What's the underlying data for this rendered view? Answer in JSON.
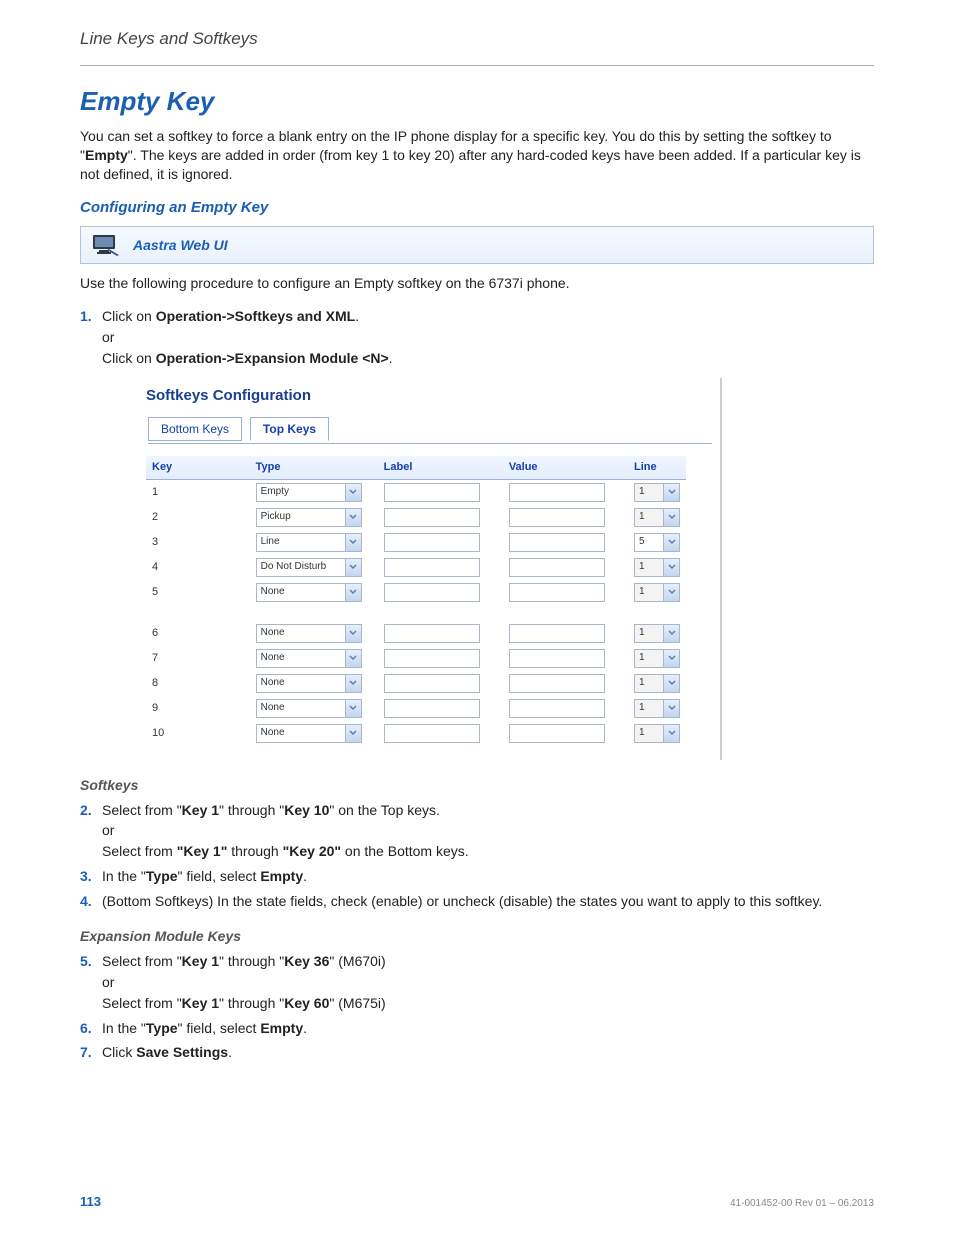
{
  "breadcrumb": "Line Keys and Softkeys",
  "title": "Empty Key",
  "intro": "You can set a softkey to force a blank entry on the IP phone display for a specific key. You do this by setting the softkey to \"",
  "intro_bold": "Empty",
  "intro_tail": "\". The keys are added in order (from key 1 to key 20) after any hard-coded keys have been added. If a particular key is not defined, it is ignored.",
  "sub1": "Configuring an Empty Key",
  "webui_label": "Aastra Web UI",
  "lead": "Use the following procedure to configure an Empty softkey on the 6737i phone.",
  "step1_a": "Click on ",
  "step1_b": "Operation->Softkeys and XML",
  "step1_c": ".",
  "or": "or",
  "step1_d": "Click on ",
  "step1_e": "Operation->Expansion Module <N>",
  "step1_f": ".",
  "screenshot": {
    "title": "Softkeys Configuration",
    "tabs": {
      "bottom": "Bottom Keys",
      "top": "Top Keys"
    },
    "headers": {
      "key": "Key",
      "type": "Type",
      "label": "Label",
      "value": "Value",
      "line": "Line"
    },
    "rows": [
      {
        "key": "1",
        "type": "Empty",
        "line": "1",
        "line_disabled": true
      },
      {
        "key": "2",
        "type": "Pickup",
        "line": "1",
        "line_disabled": true
      },
      {
        "key": "3",
        "type": "Line",
        "line": "5",
        "line_disabled": false
      },
      {
        "key": "4",
        "type": "Do Not Disturb",
        "line": "1",
        "line_disabled": true
      },
      {
        "key": "5",
        "type": "None",
        "line": "1",
        "line_disabled": true
      },
      {
        "gap": true
      },
      {
        "key": "6",
        "type": "None",
        "line": "1",
        "line_disabled": true
      },
      {
        "key": "7",
        "type": "None",
        "line": "1",
        "line_disabled": true
      },
      {
        "key": "8",
        "type": "None",
        "line": "1",
        "line_disabled": true
      },
      {
        "key": "9",
        "type": "None",
        "line": "1",
        "line_disabled": true
      },
      {
        "key": "10",
        "type": "None",
        "line": "1",
        "line_disabled": true
      }
    ]
  },
  "h_softkeys": "Softkeys",
  "step2_a": "Select from \"",
  "step2_b": "Key 1",
  "step2_c": "\" through \"",
  "step2_d": "Key 10",
  "step2_e": "\" on the Top keys.",
  "step2_f": "Select from ",
  "step2_g": "\"Key 1\"",
  "step2_h": " through ",
  "step2_i": "\"Key 20\"",
  "step2_j": " on the Bottom keys.",
  "step3_a": "In the \"",
  "step3_b": "Type",
  "step3_c": "\" field, select ",
  "step3_d": "Empty",
  "step3_e": ".",
  "step4": "(Bottom Softkeys) In the state fields, check (enable) or uncheck (disable) the states you want to apply to this softkey.",
  "h_exp": "Expansion Module Keys",
  "step5_a": "Select from \"",
  "step5_b": "Key 1",
  "step5_c": "\" through \"",
  "step5_d": "Key 36",
  "step5_e": "\" (M670i)",
  "step5_f": "Select from \"",
  "step5_g": "Key 1",
  "step5_h": "\" through \"",
  "step5_i": "Key 60",
  "step5_j": "\" (M675i)",
  "step7_a": "Click ",
  "step7_b": "Save Settings",
  "step7_c": ".",
  "page_num": "113",
  "doc_id": "41-001452-00 Rev 01 – 06.2013"
}
